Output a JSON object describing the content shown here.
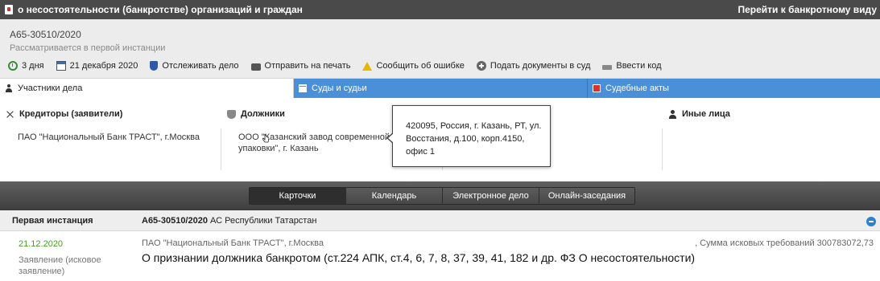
{
  "app": {
    "title": "о несостоятельности (банкротстве) организаций и граждан",
    "switch_view": "Перейти к банкротному виду"
  },
  "case": {
    "number": "А65-30510/2020",
    "status": "Рассматривается в первой инстанции"
  },
  "toolbar": {
    "days": "3 дня",
    "date": "21 декабря 2020",
    "track": "Отслеживать дело",
    "print": "Отправить на печать",
    "report_error": "Сообщить об ошибке",
    "submit_docs": "Подать документы в суд",
    "enter_code": "Ввести код"
  },
  "tabs": {
    "participants": "Участники дела",
    "courts": "Суды и судьи",
    "acts": "Судебные акты"
  },
  "participants": {
    "creditors_title": "Кредиторы (заявители)",
    "creditor_1": "ПАО \"Национальный Банк ТРАСТ\", г.Москва",
    "debtors_title": "Должники",
    "debtor_1": "ООО \"Казанский завод современной упаковки\", г. Казань",
    "others_title": "Иные лица"
  },
  "tooltip": {
    "address": "420095, Россия, г. Казань, РТ, ул. Восстания, д.100, корп.4150, офис 1"
  },
  "nav": {
    "cards": "Карточки",
    "calendar": "Календарь",
    "e_case": "Электронное дело",
    "online": "Онлайн-заседания"
  },
  "instance": {
    "title": "Первая инстанция",
    "case_number": "А65-30510/2020",
    "court": "АС Республики Татарстан"
  },
  "record": {
    "date": "21.12.2020",
    "type": "Заявление (исковое заявление)",
    "party": "ПАО \"Национальный Банк ТРАСТ\", г.Москва",
    "subject": "О признании должника банкротом (ст.224 АПК, ст.4, 6, 7, 8, 37, 39, 41, 182 и др. ФЗ О несостоятельности)",
    "sum": ", Сумма исковых требований 300783072,73"
  },
  "colors": {
    "topbar": "#4a4a4a",
    "tab_blue": "#4a90d9",
    "date_green": "#4a9a2a",
    "collapse_blue": "#2f7fd1"
  }
}
